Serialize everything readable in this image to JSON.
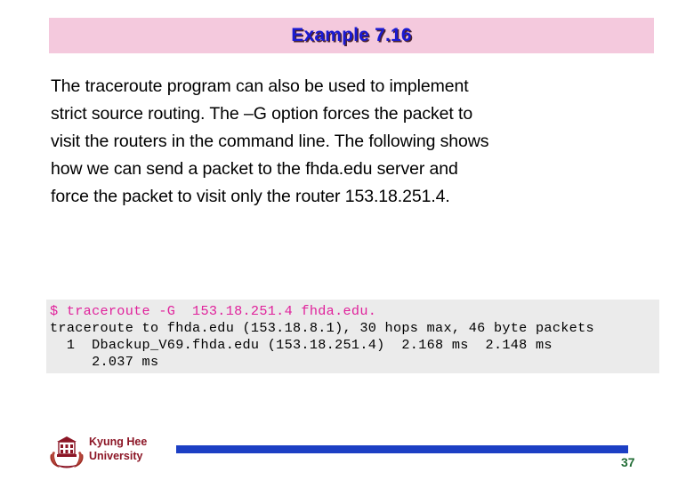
{
  "slide": {
    "title": "Example 7.16",
    "page_number": "37",
    "colors": {
      "title_banner_bg": "#f4c9dd",
      "title_text": "#1a1ad2",
      "title_shadow": "#4a2230",
      "code_bg": "#ebebeb",
      "code_command": "#e0219b",
      "footer_bar": "#1c3fc4",
      "footer_name": "#8c1626",
      "page_number": "#1f6b33"
    }
  },
  "body": {
    "lines": [
      "The traceroute program can also be used to implement",
      "strict source routing. The –G option forces the packet to",
      "visit the routers in the command line. The following shows",
      "how we can send a packet to the fhda.edu server and",
      "force the packet to visit only the router 153.18.251.4."
    ]
  },
  "code": {
    "lines": [
      {
        "text": "$ traceroute -G  153.18.251.4 fhda.edu.",
        "kind": "command"
      },
      {
        "text": "traceroute to fhda.edu (153.18.8.1), 30 hops max, 46 byte packets",
        "kind": "output"
      },
      {
        "text": "  1  Dbackup_V69.fhda.edu (153.18.251.4)  2.168 ms  2.148 ms",
        "kind": "output"
      },
      {
        "text": "     2.037 ms",
        "kind": "output"
      }
    ]
  },
  "footer": {
    "org_line1": "Kyung Hee",
    "org_line2": "University",
    "logo_name": "kyung-hee-university-emblem"
  }
}
